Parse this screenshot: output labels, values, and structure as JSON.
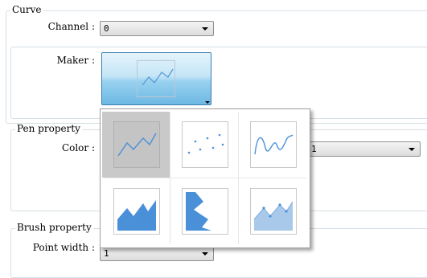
{
  "curve_group": {
    "legend": "Curve",
    "channel_label": "Channel :",
    "channel_value": "0",
    "maker_label": "Maker :",
    "maker_selected": "line-marker-icon"
  },
  "pen_group": {
    "legend": "Pen property",
    "color_label": "Color :",
    "partial_value": "1"
  },
  "brush_group": {
    "legend": "Brush property",
    "point_width_label": "Point width :",
    "point_width_value": "1"
  },
  "maker_options": [
    {
      "icon": "line-curve-icon",
      "selected": true
    },
    {
      "icon": "scatter-points-icon",
      "selected": false
    },
    {
      "icon": "smooth-curve-icon",
      "selected": false
    },
    {
      "icon": "area-chart-icon",
      "selected": false
    },
    {
      "icon": "vertical-area-icon",
      "selected": false
    },
    {
      "icon": "area-with-points-icon",
      "selected": false
    }
  ],
  "colors": {
    "accent": "#5b9bd5",
    "area_fill": "#4a90d9",
    "light_area_fill": "#a9c9ea",
    "selected_cell": "#c9c9c9"
  }
}
